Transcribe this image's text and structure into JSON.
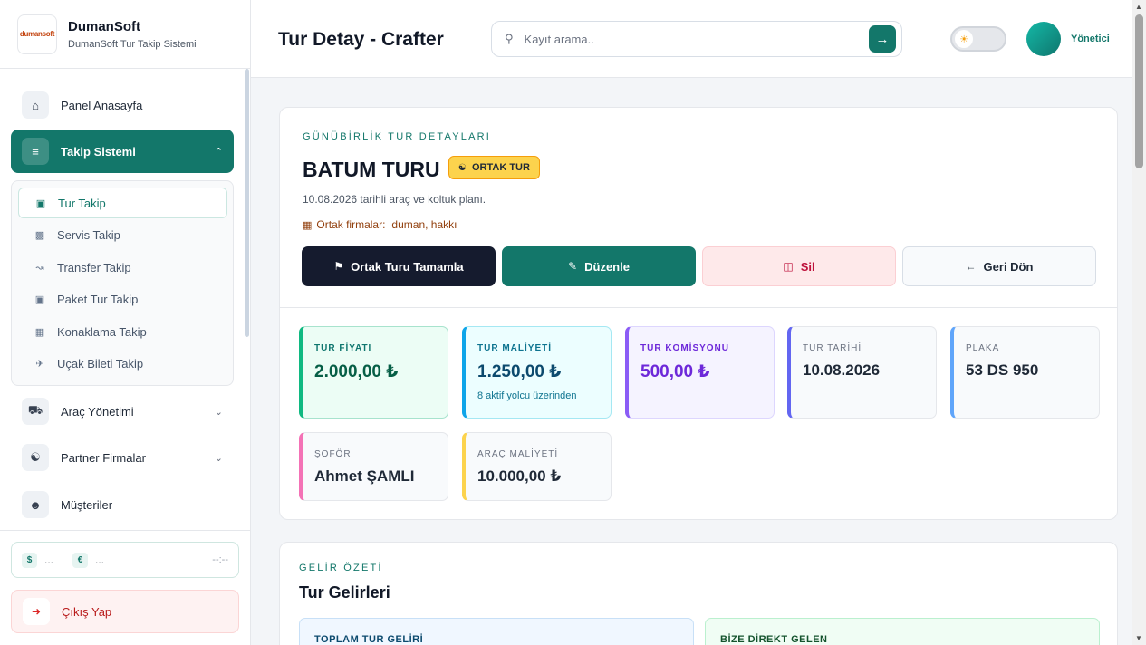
{
  "brand": {
    "logo_text": "dumansoft",
    "name": "DumanSoft",
    "subtitle": "DumanSoft Tur Takip Sistemi"
  },
  "sidebar": {
    "items": [
      {
        "label": "Panel Anasayfa",
        "icon": "home-icon"
      },
      {
        "label": "Takip Sistemi",
        "icon": "list-check-icon",
        "active": true,
        "expanded": true
      },
      {
        "label": "Araç Yönetimi",
        "icon": "car-icon"
      },
      {
        "label": "Partner Firmalar",
        "icon": "handshake-icon"
      },
      {
        "label": "Müşteriler",
        "icon": "users-icon"
      }
    ],
    "submenu": [
      {
        "label": "Tur Takip",
        "icon": "bus-icon",
        "active": true
      },
      {
        "label": "Servis Takip",
        "icon": "van-icon"
      },
      {
        "label": "Transfer Takip",
        "icon": "route-icon"
      },
      {
        "label": "Paket Tur Takip",
        "icon": "suitcase-icon"
      },
      {
        "label": "Konaklama Takip",
        "icon": "hotel-icon"
      },
      {
        "label": "Uçak Bileti Takip",
        "icon": "plane-icon"
      }
    ],
    "currency": {
      "usd_symbol": "$",
      "usd_value": "...",
      "eur_symbol": "€",
      "eur_value": "...",
      "time": "--:--"
    },
    "logout_label": "Çıkış Yap"
  },
  "header": {
    "title": "Tur Detay - Crafter",
    "search_placeholder": "Kayıt arama..",
    "user_name": "Yönetici"
  },
  "tour": {
    "eyebrow": "GÜNÜBİRLİK TUR DETAYLARI",
    "name": "BATUM TURU",
    "badge": "ORTAK TUR",
    "plan_text": "10.08.2026 tarihli araç ve koltuk planı.",
    "partners_label": "Ortak firmalar:",
    "partners_value": "duman, hakkı",
    "actions": {
      "complete": "Ortak Turu Tamamla",
      "edit": "Düzenle",
      "delete": "Sil",
      "back": "Geri Dön"
    },
    "stats": [
      {
        "label": "TUR FİYATI",
        "value": "2.000,00 ₺"
      },
      {
        "label": "TUR MALİYETİ",
        "value": "1.250,00 ₺",
        "note": "8 aktif yolcu üzerinden"
      },
      {
        "label": "TUR KOMİSYONU",
        "value": "500,00 ₺"
      },
      {
        "label": "TUR TARİHİ",
        "value": "10.08.2026"
      },
      {
        "label": "PLAKA",
        "value": "53 DS 950"
      },
      {
        "label": "ŞOFÖR",
        "value": "Ahmet ŞAMLI"
      },
      {
        "label": "ARAÇ MALİYETİ",
        "value": "10.000,00 ₺"
      }
    ]
  },
  "income": {
    "eyebrow": "GELİR ÖZETİ",
    "title": "Tur Gelirleri",
    "cards": [
      {
        "label": "TOPLAM TUR GELİRİ"
      },
      {
        "label": "BİZE DİREKT GELEN"
      }
    ]
  },
  "colors": {
    "accent": "#13776a",
    "dark_button": "#151b2e",
    "badge": "#fcd34d"
  }
}
